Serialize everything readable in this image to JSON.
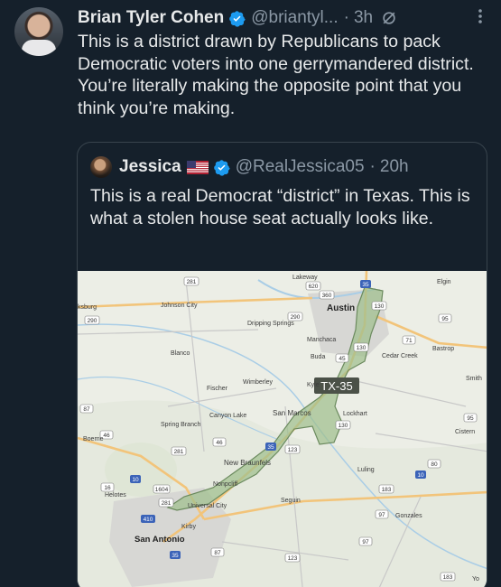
{
  "tweet": {
    "author_name": "Brian Tyler Cohen",
    "handle": "@briantyl...",
    "time": "3h",
    "text": "This is a district drawn by Republicans to pack Democratic voters into one gerrymandered district. You’re literally making the opposite point that you think you’re making."
  },
  "quote": {
    "author_name": "Jessica",
    "handle": "@RealJessica05",
    "time": "20h",
    "text": "This is a real Democrat “district” in Texas. This is what a stolen house seat actually looks like."
  },
  "map": {
    "district_label": "TX-35",
    "places": {
      "lakeway": "Lakeway",
      "elgin": "Elgin",
      "austin": "Austin",
      "sburg": "ksburg",
      "johnson_city": "Johnson City",
      "dripping_springs": "Dripping Springs",
      "manchaca": "Manchaca",
      "bastrop": "Bastrop",
      "blanco": "Blanco",
      "buda": "Buda",
      "cedar_creek": "Cedar Creek",
      "smith": "Smith",
      "wimberley": "Wimberley",
      "fischer": "Fischer",
      "kyle": "Kyle",
      "canyon_lake": "Canyon Lake",
      "san_marcos": "San Marcos",
      "lockhart": "Lockhart",
      "spring_branch": "Spring Branch",
      "boerne": "Boerne",
      "cistern": "Cistern",
      "new_braunfels": "New Braunfels",
      "luling": "Luling",
      "nonpcliff": "Nonpcliff",
      "helotes": "Helotes",
      "universal_city": "Universal City",
      "seguin": "Seguin",
      "gonzales": "Gonzales",
      "kirby": "Kirby",
      "san_antonio": "San Antonio",
      "yo": "Yo"
    },
    "shields": {
      "s281": "281",
      "s620": "620",
      "s35n": "35",
      "s360": "360",
      "s130": "130",
      "s290w": "290",
      "s290": "290",
      "s290e": "290",
      "s95": "95",
      "s71": "71",
      "s45": "45",
      "s87": "87",
      "s46": "46",
      "s21": "21",
      "s183": "183",
      "s80": "80",
      "s123": "123",
      "s10": "10",
      "s1604": "1604",
      "s16": "16",
      "s281b": "281",
      "s410": "410",
      "s35s": "35",
      "s87b": "87",
      "s97": "97",
      "s123b": "123",
      "s183b": "183"
    }
  },
  "colors": {
    "background": "#15202b",
    "verified": "#1d9bf0",
    "muted": "#8b98a5",
    "district_fill": "#9fbf8e",
    "district_stroke": "#6b8a5e"
  },
  "icons": [
    "verified-badge-icon",
    "grok-icon",
    "more-options-icon",
    "us-flag-icon"
  ]
}
